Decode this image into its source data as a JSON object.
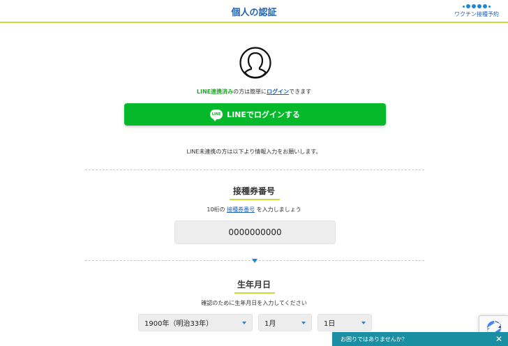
{
  "header": {
    "title": "個人の認証",
    "brand_text": "ワクチン接種予約"
  },
  "line_login": {
    "note_green": "LINE連携済み",
    "note_mid": "の方は簡単に",
    "note_link": "ログイン",
    "note_end": "できます",
    "badge": "LINE",
    "button_label": "LINEでログインする"
  },
  "unlinked_note": "LINE未連携の方は以下より情報入力をお願いします。",
  "ticket": {
    "title": "接種券番号",
    "note_start": "10桁の",
    "note_link": "接種券番号",
    "note_end": "を入力しましょう",
    "value": "0000000000"
  },
  "birthdate": {
    "title": "生年月日",
    "note": "確認のために生年月日を入力してください",
    "year": "1900年（明治33年）",
    "month": "1月",
    "day": "1日"
  },
  "help_bar": {
    "label": "お困りではありませんか？",
    "close": "✕"
  },
  "colors": {
    "accent_blue": "#1e63b4",
    "line_green": "#06b92a",
    "underline_lime": "#c8dc3c",
    "help_teal": "#1a8fa3"
  }
}
